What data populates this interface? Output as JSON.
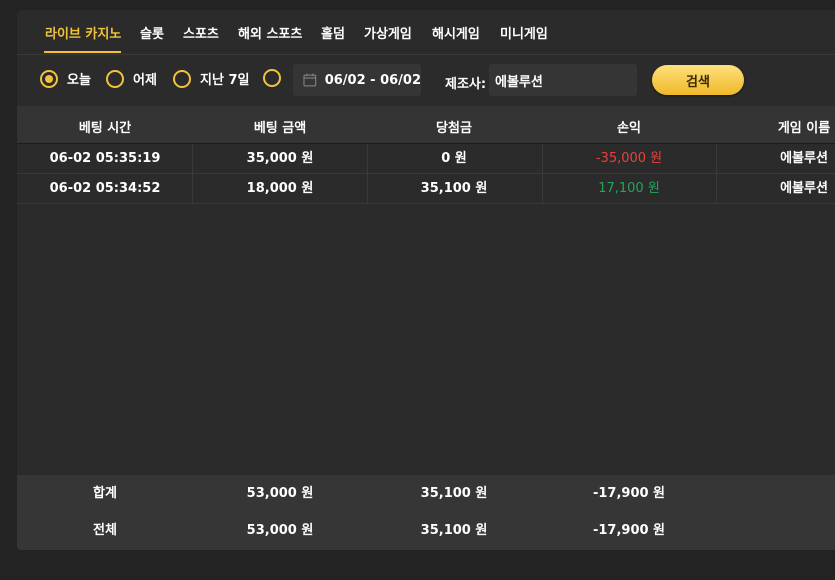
{
  "tabs": [
    {
      "label": "라이브 카지노",
      "active": true
    },
    {
      "label": "슬롯",
      "active": false
    },
    {
      "label": "스포츠",
      "active": false
    },
    {
      "label": "해외 스포츠",
      "active": false
    },
    {
      "label": "홀덤",
      "active": false
    },
    {
      "label": "가상게임",
      "active": false
    },
    {
      "label": "해시게임",
      "active": false
    },
    {
      "label": "미니게임",
      "active": false
    }
  ],
  "filter": {
    "periods": [
      {
        "label": "오늘",
        "selected": true
      },
      {
        "label": "어제",
        "selected": false
      },
      {
        "label": "지난 7일",
        "selected": false
      },
      {
        "label": "",
        "selected": false
      }
    ],
    "date_range": "06/02 - 06/02",
    "manufacturer_label": "제조사:",
    "manufacturer_value": "에볼루션",
    "search_label": "검색"
  },
  "table": {
    "columns": [
      "베팅 시간",
      "베팅 금액",
      "당첨금",
      "손익",
      "게임 이름"
    ],
    "rows": [
      {
        "time": "06-02 05:35:19",
        "bet": "35,000 원",
        "win": "0 원",
        "profit": "-35,000 원",
        "profit_sign": "negative",
        "game": "에볼루션"
      },
      {
        "time": "06-02 05:34:52",
        "bet": "18,000 원",
        "win": "35,100 원",
        "profit": "17,100 원",
        "profit_sign": "positive",
        "game": "에볼루션"
      }
    ],
    "footer": [
      {
        "label": "합계",
        "bet": "53,000 원",
        "win": "35,100 원",
        "profit": "-17,900 원"
      },
      {
        "label": "전체",
        "bet": "53,000 원",
        "win": "35,100 원",
        "profit": "-17,900 원"
      }
    ]
  },
  "colors": {
    "accent": "#f2c23a",
    "negative": "#e8413b",
    "positive": "#22a65a",
    "background": "#232323",
    "panel": "#2b2b2b"
  }
}
